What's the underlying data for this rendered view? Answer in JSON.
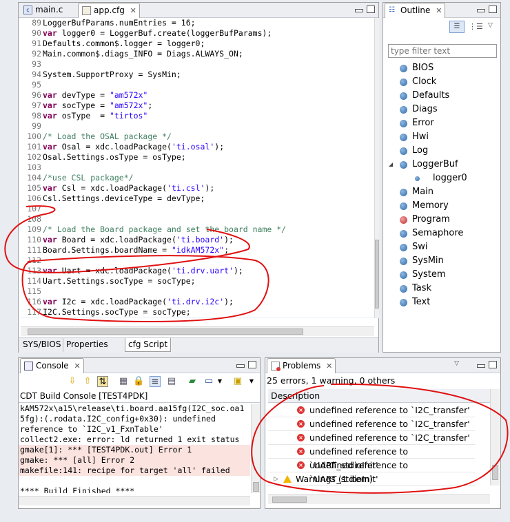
{
  "editor": {
    "tabs": [
      {
        "label": "main.c",
        "icon": "c-file-icon"
      },
      {
        "label": "app.cfg",
        "icon": "cfg-file-icon"
      }
    ],
    "lines": [
      {
        "n": "89",
        "segs": [
          {
            "t": "LoggerBufParams.numEntries = 16;",
            "c": ""
          }
        ]
      },
      {
        "n": "90",
        "segs": [
          {
            "t": "var",
            "c": "kw"
          },
          {
            "t": " logger0 = LoggerBuf.create(loggerBufParams);",
            "c": ""
          }
        ]
      },
      {
        "n": "91",
        "segs": [
          {
            "t": "Defaults.common$.logger = logger0;",
            "c": ""
          }
        ]
      },
      {
        "n": "92",
        "segs": [
          {
            "t": "Main.common$.diags_INFO = Diags.ALWAYS_ON;",
            "c": ""
          }
        ]
      },
      {
        "n": "93",
        "segs": []
      },
      {
        "n": "94",
        "segs": [
          {
            "t": "System.SupportProxy = SysMin;",
            "c": ""
          }
        ]
      },
      {
        "n": "95",
        "segs": []
      },
      {
        "n": "96",
        "segs": [
          {
            "t": "var",
            "c": "kw"
          },
          {
            "t": " devType = ",
            "c": ""
          },
          {
            "t": "\"am572x\"",
            "c": "str"
          }
        ]
      },
      {
        "n": "97",
        "segs": [
          {
            "t": "var",
            "c": "kw"
          },
          {
            "t": " socType = ",
            "c": ""
          },
          {
            "t": "\"am572x\"",
            "c": "str"
          },
          {
            "t": ";",
            "c": ""
          }
        ]
      },
      {
        "n": "98",
        "segs": [
          {
            "t": "var",
            "c": "kw"
          },
          {
            "t": " osType  = ",
            "c": ""
          },
          {
            "t": "\"tirtos\"",
            "c": "str"
          }
        ]
      },
      {
        "n": "99",
        "segs": []
      },
      {
        "n": "100",
        "segs": [
          {
            "t": "/* Load the OSAL package */",
            "c": "com"
          }
        ]
      },
      {
        "n": "101",
        "segs": [
          {
            "t": "var",
            "c": "kw"
          },
          {
            "t": " Osal = xdc.loadPackage(",
            "c": ""
          },
          {
            "t": "'ti.osal'",
            "c": "str"
          },
          {
            "t": ");",
            "c": ""
          }
        ]
      },
      {
        "n": "102",
        "segs": [
          {
            "t": "Osal.Settings.osType = osType;",
            "c": ""
          }
        ]
      },
      {
        "n": "103",
        "segs": []
      },
      {
        "n": "104",
        "segs": [
          {
            "t": "/*use CSL package*/",
            "c": "com"
          }
        ]
      },
      {
        "n": "105",
        "segs": [
          {
            "t": "var",
            "c": "kw"
          },
          {
            "t": " Csl = xdc.loadPackage(",
            "c": ""
          },
          {
            "t": "'ti.csl'",
            "c": "str"
          },
          {
            "t": ");",
            "c": ""
          }
        ]
      },
      {
        "n": "106",
        "segs": [
          {
            "t": "Csl.Settings.deviceType = devType;",
            "c": ""
          }
        ]
      },
      {
        "n": "107",
        "segs": []
      },
      {
        "n": "108",
        "segs": []
      },
      {
        "n": "109",
        "segs": [
          {
            "t": "/* Load the Board package and set the board name */",
            "c": "com"
          }
        ]
      },
      {
        "n": "110",
        "segs": [
          {
            "t": "var",
            "c": "kw"
          },
          {
            "t": " Board = xdc.loadPackage(",
            "c": ""
          },
          {
            "t": "'ti.board'",
            "c": "str"
          },
          {
            "t": ");",
            "c": ""
          }
        ]
      },
      {
        "n": "111",
        "segs": [
          {
            "t": "Board.Settings.boardName = ",
            "c": ""
          },
          {
            "t": "\"idkAM572x\"",
            "c": "str"
          },
          {
            "t": ";",
            "c": ""
          }
        ]
      },
      {
        "n": "112",
        "segs": []
      },
      {
        "n": "113",
        "segs": [
          {
            "t": "var",
            "c": "kw"
          },
          {
            "t": " Uart = xdc.loadPackage(",
            "c": ""
          },
          {
            "t": "'ti.drv.uart'",
            "c": "str"
          },
          {
            "t": ");",
            "c": ""
          }
        ]
      },
      {
        "n": "114",
        "segs": [
          {
            "t": "Uart.Settings.socType = socType;",
            "c": ""
          }
        ]
      },
      {
        "n": "115",
        "segs": []
      },
      {
        "n": "116",
        "segs": [
          {
            "t": "var",
            "c": "kw"
          },
          {
            "t": " I2c = xdc.loadPackage(",
            "c": ""
          },
          {
            "t": "'ti.drv.i2c'",
            "c": "str"
          },
          {
            "t": ");",
            "c": ""
          }
        ]
      },
      {
        "n": "117",
        "segs": [
          {
            "t": "I2C.Settings.socType = socType;",
            "c": ""
          }
        ]
      },
      {
        "n": "118",
        "segs": []
      }
    ],
    "bottom_tabs": [
      "SYS/BIOS",
      "Properties",
      "cfg Script"
    ]
  },
  "outline": {
    "title": "Outline",
    "filter_placeholder": "type filter text",
    "items": [
      {
        "label": "BIOS",
        "color": "blue"
      },
      {
        "label": "Clock",
        "color": "blue"
      },
      {
        "label": "Defaults",
        "color": "blue"
      },
      {
        "label": "Diags",
        "color": "blue"
      },
      {
        "label": "Error",
        "color": "blue"
      },
      {
        "label": "Hwi",
        "color": "blue"
      },
      {
        "label": "Log",
        "color": "blue"
      },
      {
        "label": "LoggerBuf",
        "color": "blue",
        "expanded": true
      },
      {
        "label": "logger0",
        "color": "blue",
        "child": true
      },
      {
        "label": "Main",
        "color": "blue"
      },
      {
        "label": "Memory",
        "color": "blue"
      },
      {
        "label": "Program",
        "color": "red"
      },
      {
        "label": "Semaphore",
        "color": "blue"
      },
      {
        "label": "Swi",
        "color": "blue"
      },
      {
        "label": "SysMin",
        "color": "blue"
      },
      {
        "label": "System",
        "color": "blue"
      },
      {
        "label": "Task",
        "color": "blue"
      },
      {
        "label": "Text",
        "color": "blue"
      }
    ]
  },
  "console": {
    "title": "Console",
    "subtitle": "CDT Build Console [TEST4PDK]",
    "lines": [
      {
        "t": "kAM572x\\a15\\release\\ti.board.aa15fg(I2C_soc.oa1",
        "err": false
      },
      {
        "t": "5fg):(.rodata.I2C_config+0x30): undefined",
        "err": false
      },
      {
        "t": "reference to `I2C_v1_FxnTable'",
        "err": false
      },
      {
        "t": "collect2.exe: error: ld returned 1 exit status",
        "err": false
      },
      {
        "t": "gmake[1]: *** [TEST4PDK.out] Error 1",
        "err": true
      },
      {
        "t": "gmake: *** [all] Error 2",
        "err": true
      },
      {
        "t": "makefile:141: recipe for target 'all' failed",
        "err": true
      },
      {
        "t": "",
        "err": false
      },
      {
        "t": "**** Build Finished ****",
        "err": false
      }
    ]
  },
  "problems": {
    "title": "Problems",
    "summary": "25 errors, 1 warning, 0 others",
    "column": "Description",
    "errors": [
      "undefined reference to `I2C_transfer'",
      "undefined reference to `I2C_transfer'",
      "undefined reference to `I2C_transfer'",
      "undefined reference to `UART_stdioInit'",
      "undefined reference to `UART_stdioInit'"
    ],
    "warnings_label": "Warnings (1 item)"
  },
  "colors": {
    "keyword": "#7f0055",
    "string": "#2a00ff",
    "comment": "#3f7f5f",
    "error_bg": "#fbe3e0",
    "annotation": "#e01010"
  }
}
